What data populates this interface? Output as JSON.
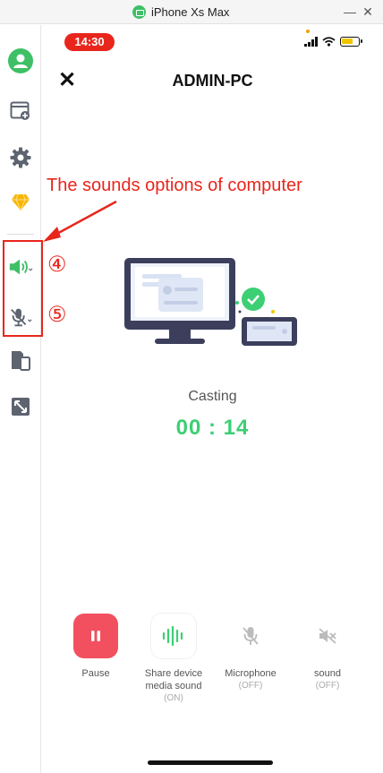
{
  "window": {
    "title": "iPhone Xs Max",
    "minimize_glyph": "—",
    "close_glyph": "✕"
  },
  "sidebar": {
    "items": [
      {
        "name": "profile",
        "icon": "user-avatar-icon"
      },
      {
        "name": "add-window",
        "icon": "window-add-icon"
      },
      {
        "name": "settings",
        "icon": "gear-icon"
      },
      {
        "name": "premium",
        "icon": "diamond-icon"
      },
      {
        "name": "speaker",
        "icon": "speaker-icon"
      },
      {
        "name": "microphone",
        "icon": "microphone-muted-icon"
      },
      {
        "name": "screen-share",
        "icon": "device-share-icon"
      },
      {
        "name": "fullscreen",
        "icon": "expand-icon"
      }
    ]
  },
  "annotation": {
    "callout_text": "The sounds options of computer",
    "number_4": "④",
    "number_5": "⑤",
    "color": "#e8261c"
  },
  "phone": {
    "status": {
      "time": "14:30"
    },
    "header": {
      "close_glyph": "✕",
      "title": "ADMIN-PC"
    },
    "casting": {
      "label": "Casting",
      "timer": "00 : 14"
    },
    "controls": [
      {
        "name": "pause",
        "label": "Pause",
        "sub": "",
        "icon": "pause-icon"
      },
      {
        "name": "share-device-media-sound",
        "label_line1": "Share device",
        "label_line2": "media sound",
        "sub": "(ON)",
        "icon": "sound-wave-icon"
      },
      {
        "name": "microphone",
        "label": "Microphone",
        "sub": "(OFF)",
        "icon": "microphone-muted-icon"
      },
      {
        "name": "sound",
        "label": "sound",
        "sub": "(OFF)",
        "icon": "speaker-muted-icon"
      }
    ]
  },
  "colors": {
    "accent_green": "#3ccf74",
    "pause_red": "#f2505f",
    "status_red": "#e8261c"
  }
}
